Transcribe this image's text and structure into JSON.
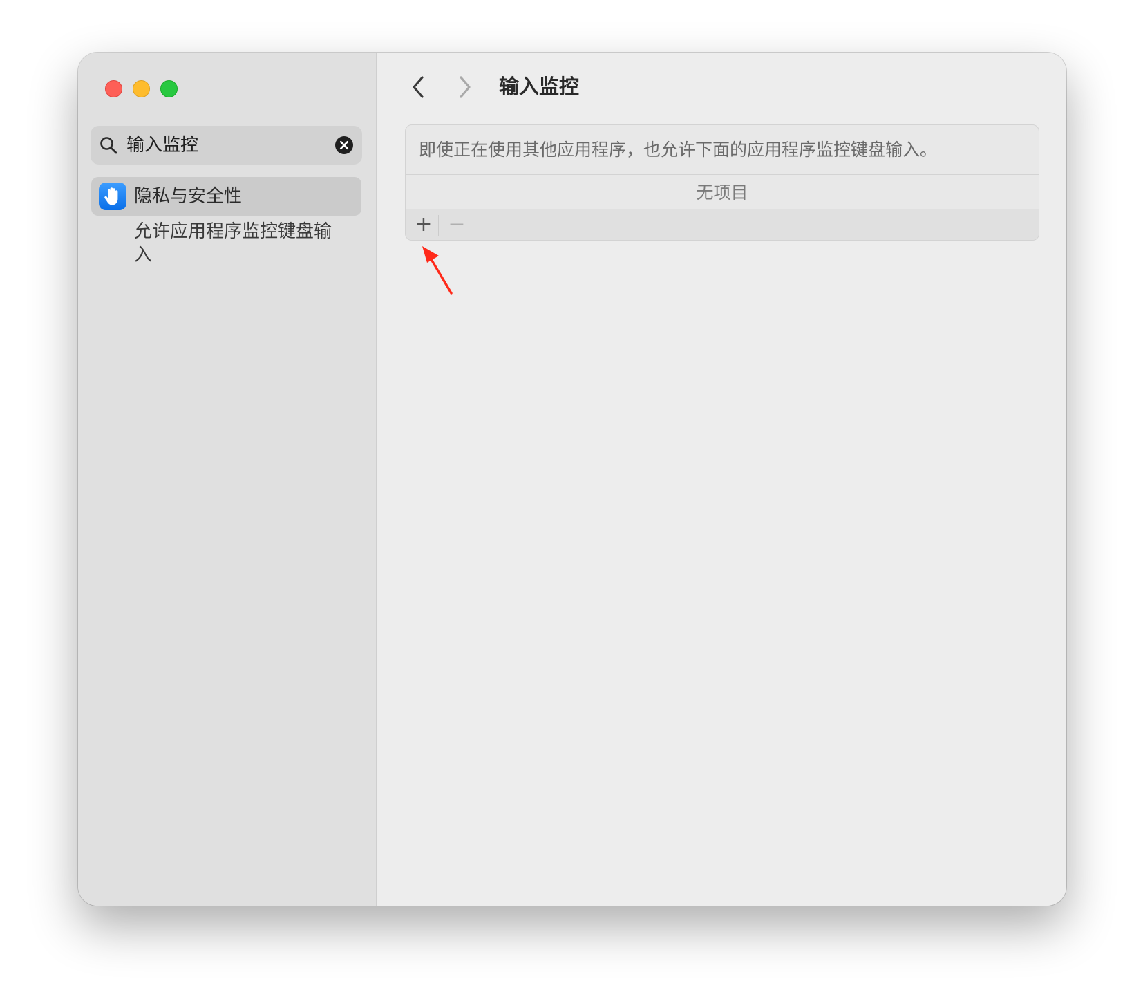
{
  "window": {
    "traffic_lights": {
      "close": "#fe5f57",
      "minimize": "#febc2e",
      "maximize": "#28c840"
    }
  },
  "sidebar": {
    "search": {
      "value": "输入监控",
      "icon": "search-icon",
      "clear_icon": "clear-circle-icon"
    },
    "items": [
      {
        "label": "隐私与安全性",
        "icon": "raised-hand-icon",
        "icon_color": "#1a7ff5",
        "selected": true,
        "sub_label": "允许应用程序监控键盘输入"
      }
    ]
  },
  "content": {
    "nav": {
      "back_icon": "chevron-left-icon",
      "forward_icon": "chevron-right-icon"
    },
    "title": "输入监控",
    "panel": {
      "description": "即使正在使用其他应用程序，也允许下面的应用程序监控键盘输入。",
      "empty_text": "无项目",
      "add_label": "+",
      "remove_label": "−"
    }
  },
  "annotation": {
    "arrow_color": "#ff2a1a",
    "icon": "red-arrow-icon"
  }
}
